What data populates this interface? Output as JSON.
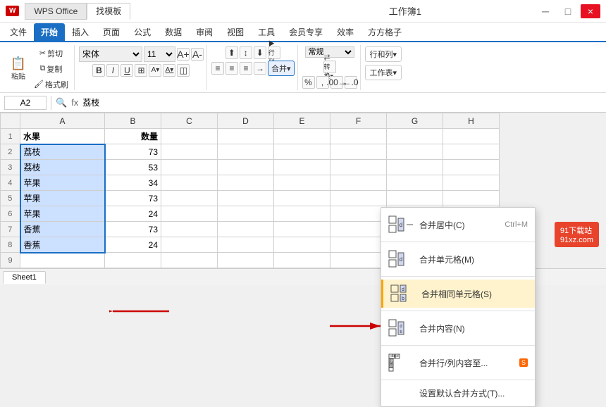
{
  "titlebar": {
    "logo": "WPS",
    "tab1": "WPS Office",
    "tab2": "找模板",
    "filename": "工作簿1",
    "controls": [
      "─",
      "□",
      "×"
    ]
  },
  "ribbon": {
    "tabs": [
      "文件",
      "开始",
      "插入",
      "页面",
      "公式",
      "数据",
      "审阅",
      "视图",
      "工具",
      "会员专享",
      "效率",
      "方方格子"
    ],
    "active_tab": "开始",
    "font": "宋体",
    "size": "11",
    "buttons": {
      "paste": "粘贴",
      "cut": "剪切",
      "copy": "复制",
      "format_paint": "格式刷"
    },
    "merge_btn": "合并▾",
    "number_format": "常规",
    "row_col": "行和列▾",
    "worksheet": "工作表▾",
    "execute_row": "▶行列"
  },
  "formula_bar": {
    "cell_ref": "A2",
    "formula_value": "荔枝"
  },
  "columns": [
    "A",
    "B",
    "C",
    "D",
    "E",
    "F",
    "G",
    "H"
  ],
  "rows": [
    {
      "num": 1,
      "a": "水果",
      "b": "数量",
      "c": "",
      "d": "",
      "e": ""
    },
    {
      "num": 2,
      "a": "荔枝",
      "b": "73",
      "c": "",
      "d": "",
      "e": ""
    },
    {
      "num": 3,
      "a": "荔枝",
      "b": "53",
      "c": "",
      "d": "",
      "e": ""
    },
    {
      "num": 4,
      "a": "苹果",
      "b": "34",
      "c": "",
      "d": "",
      "e": ""
    },
    {
      "num": 5,
      "a": "苹果",
      "b": "73",
      "c": "",
      "d": "",
      "e": ""
    },
    {
      "num": 6,
      "a": "苹果",
      "b": "24",
      "c": "",
      "d": "",
      "e": ""
    },
    {
      "num": 7,
      "a": "香蕉",
      "b": "73",
      "c": "",
      "d": "",
      "e": ""
    },
    {
      "num": 8,
      "a": "香蕉",
      "b": "24",
      "c": "",
      "d": "",
      "e": ""
    },
    {
      "num": 9,
      "a": "",
      "b": "",
      "c": "",
      "d": "",
      "e": ""
    }
  ],
  "dropdown": {
    "items": [
      {
        "id": "merge-center",
        "label": "合并居中(C)",
        "shortcut": "Ctrl+M"
      },
      {
        "id": "merge-cells",
        "label": "合并单元格(M)",
        "shortcut": ""
      },
      {
        "id": "merge-same",
        "label": "合并相同单元格(S)",
        "shortcut": "",
        "highlighted": true
      },
      {
        "id": "merge-content",
        "label": "合并内容(N)",
        "shortcut": ""
      },
      {
        "id": "merge-row-col",
        "label": "合并行/列内容至...",
        "shortcut": "",
        "badge": "S"
      },
      {
        "id": "set-default",
        "label": "设置默认合并方式(T)...",
        "shortcut": ""
      }
    ]
  },
  "sheets": [
    "Sheet1"
  ],
  "watermark": "91下载站\n91xz.com"
}
